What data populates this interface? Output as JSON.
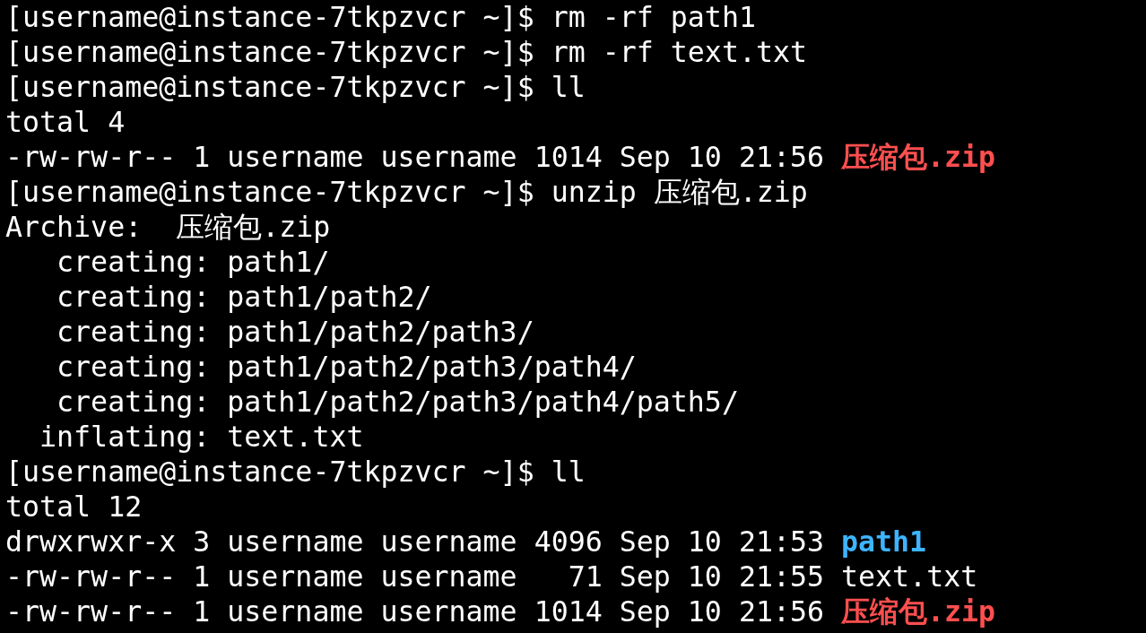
{
  "terminal": {
    "lines": [
      [
        {
          "kind": "plain",
          "text": "[username@instance-7tkpzvcr ~]$ rm -rf path1"
        }
      ],
      [
        {
          "kind": "plain",
          "text": "[username@instance-7tkpzvcr ~]$ rm -rf text.txt"
        }
      ],
      [
        {
          "kind": "plain",
          "text": "[username@instance-7tkpzvcr ~]$ ll"
        }
      ],
      [
        {
          "kind": "plain",
          "text": "total 4"
        }
      ],
      [
        {
          "kind": "plain",
          "text": "-rw-rw-r-- 1 username username 1014 Sep 10 21:56 "
        },
        {
          "kind": "archive",
          "text": "压缩包.zip"
        }
      ],
      [
        {
          "kind": "plain",
          "text": "[username@instance-7tkpzvcr ~]$ unzip 压缩包.zip"
        }
      ],
      [
        {
          "kind": "plain",
          "text": "Archive:  压缩包.zip"
        }
      ],
      [
        {
          "kind": "plain",
          "text": "   creating: path1/"
        }
      ],
      [
        {
          "kind": "plain",
          "text": "   creating: path1/path2/"
        }
      ],
      [
        {
          "kind": "plain",
          "text": "   creating: path1/path2/path3/"
        }
      ],
      [
        {
          "kind": "plain",
          "text": "   creating: path1/path2/path3/path4/"
        }
      ],
      [
        {
          "kind": "plain",
          "text": "   creating: path1/path2/path3/path4/path5/"
        }
      ],
      [
        {
          "kind": "plain",
          "text": "  inflating: text.txt"
        }
      ],
      [
        {
          "kind": "plain",
          "text": "[username@instance-7tkpzvcr ~]$ ll"
        }
      ],
      [
        {
          "kind": "plain",
          "text": "total 12"
        }
      ],
      [
        {
          "kind": "plain",
          "text": "drwxrwxr-x 3 username username 4096 Sep 10 21:53 "
        },
        {
          "kind": "directory",
          "text": "path1"
        }
      ],
      [
        {
          "kind": "plain",
          "text": "-rw-rw-r-- 1 username username   71 Sep 10 21:55 text.txt"
        }
      ],
      [
        {
          "kind": "plain",
          "text": "-rw-rw-r-- 1 username username 1014 Sep 10 21:56 "
        },
        {
          "kind": "archive",
          "text": "压缩包.zip"
        }
      ]
    ]
  }
}
